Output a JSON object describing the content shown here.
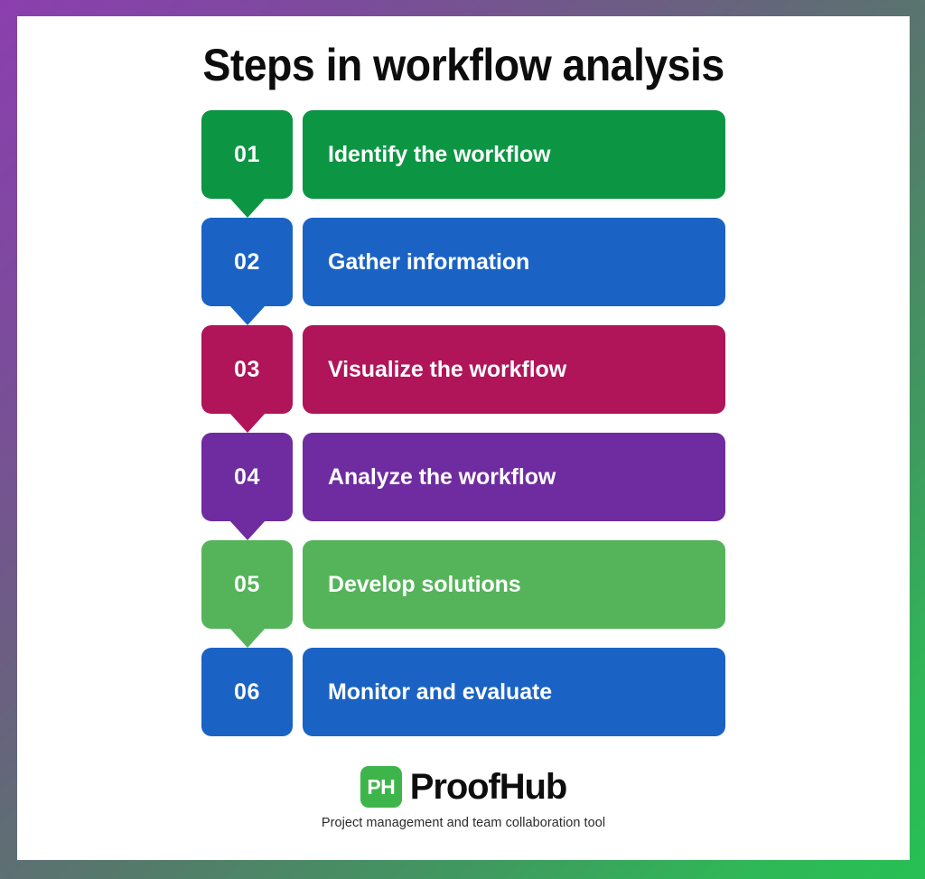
{
  "frame": {
    "gradient_start_color": "#8b3fae",
    "gradient_end_color": "#27c054"
  },
  "header": {
    "title": "Steps in workflow analysis"
  },
  "steps": [
    {
      "number": "01",
      "label": "Identify the workflow",
      "color": "#0c9543",
      "has_arrow": true
    },
    {
      "number": "02",
      "label": "Gather information",
      "color": "#1a63c4",
      "has_arrow": true
    },
    {
      "number": "03",
      "label": "Visualize the workflow",
      "color": "#b01459",
      "has_arrow": true
    },
    {
      "number": "04",
      "label": "Analyze the workflow",
      "color": "#6f2ba0",
      "has_arrow": true
    },
    {
      "number": "05",
      "label": "Develop solutions",
      "color": "#55b45a",
      "has_arrow": true
    },
    {
      "number": "06",
      "label": "Monitor and evaluate",
      "color": "#1a63c4",
      "has_arrow": false
    }
  ],
  "footer": {
    "logo_mark_text": "PH",
    "logo_mark_color": "#3eb54b",
    "brand_name": "ProofHub",
    "tagline": "Project management and team collaboration tool"
  }
}
